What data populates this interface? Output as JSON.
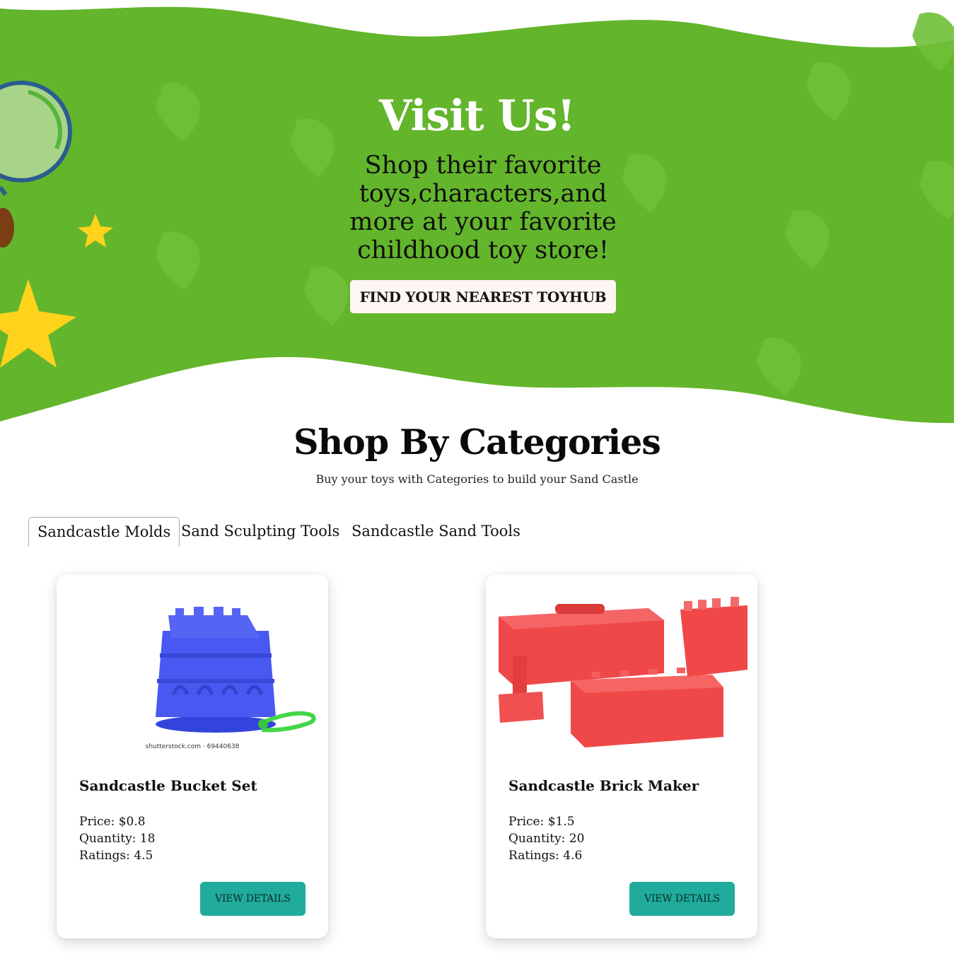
{
  "hero": {
    "title": "Visit Us!",
    "text": "Shop their favorite toys,characters,and more at your favorite childhood toy store!",
    "button_label": "FIND YOUR NEAREST TOYHUB",
    "colors": {
      "background": "#63b52c",
      "button": "#fdf6f2"
    }
  },
  "categories": {
    "title": "Shop By Categories",
    "subtitle": "Buy your toys with Categories to build your Sand Castle",
    "tabs": [
      {
        "label": "Sandcastle Molds",
        "active": true
      },
      {
        "label": "Sand Sculpting Tools",
        "active": false
      },
      {
        "label": "Sandcastle Sand Tools",
        "active": false
      }
    ]
  },
  "products": [
    {
      "name": "Sandcastle Bucket Set",
      "price": "Price: $0.8",
      "quantity": "Quantity: 18",
      "ratings": "Ratings: 4.5",
      "button_label": "VIEW DETAILS",
      "image_watermark": "shutterstock.com · 69440638",
      "image_color": "#3f4ff0"
    },
    {
      "name": "Sandcastle Brick Maker",
      "price": "Price: $1.5",
      "quantity": "Quantity: 20",
      "ratings": "Ratings: 4.6",
      "button_label": "VIEW DETAILS",
      "image_color": "#ef4444"
    }
  ],
  "accent_color": "#20ab9c"
}
